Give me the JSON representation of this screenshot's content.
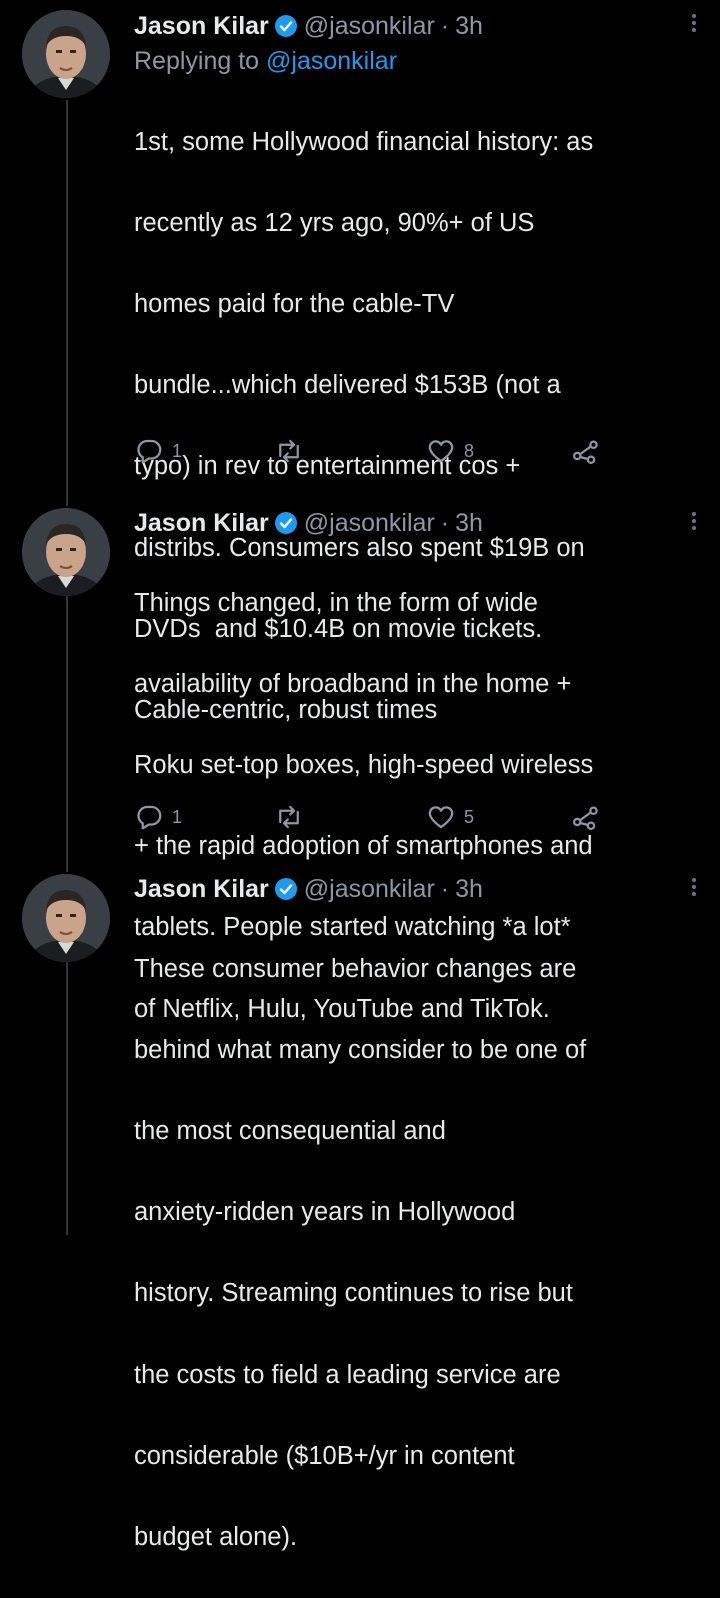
{
  "tweets": [
    {
      "author": {
        "name": "Jason Kilar",
        "handle": "@jasonkilar",
        "time": "3h",
        "separator": "·"
      },
      "reply_to": {
        "prefix": "Replying to",
        "mention": "@jasonkilar"
      },
      "lines": [
        "1st, some Hollywood financial history: as",
        "recently as 12 yrs ago, 90%+ of US",
        "homes paid for the cable-TV",
        "bundle...which delivered $153B (not a",
        "typo) in rev to entertainment cos +",
        "distribs. Consumers also spent $19B on",
        "DVDs  and $10.4B on movie tickets.",
        "Cable-centric, robust times"
      ],
      "actions": {
        "reply_count": "1",
        "retweet_count": "",
        "like_count": "8"
      }
    },
    {
      "author": {
        "name": "Jason Kilar",
        "handle": "@jasonkilar",
        "time": "3h",
        "separator": "·"
      },
      "lines": [
        "Things changed, in the form of wide",
        "availability of broadband in the home +",
        "Roku set-top boxes, high-speed wireless",
        "+ the rapid adoption of smartphones and",
        "tablets. People started watching *a lot*",
        "of Netflix, Hulu, YouTube and TikTok."
      ],
      "actions": {
        "reply_count": "1",
        "retweet_count": "",
        "like_count": "5"
      }
    },
    {
      "author": {
        "name": "Jason Kilar",
        "handle": "@jasonkilar",
        "time": "3h",
        "separator": "·"
      },
      "lines": [
        "These consumer behavior changes are",
        "behind what many consider to be one of",
        "the most consequential and",
        "anxiety-ridden years in Hollywood",
        "history. Streaming continues to rise but",
        "the costs to field a leading service are",
        "considerable ($10B+/yr in content",
        "budget alone)."
      ]
    }
  ],
  "icons": {
    "verified": "verified-badge-icon",
    "more": "more-options-icon",
    "reply": "reply-icon",
    "retweet": "retweet-icon",
    "like": "heart-icon",
    "share": "share-icon"
  },
  "colors": {
    "background": "#000000",
    "text": "#e7e9ea",
    "secondary_text": "#8b98a5",
    "accent": "#1d9bf0",
    "thread_line": "#333639"
  }
}
